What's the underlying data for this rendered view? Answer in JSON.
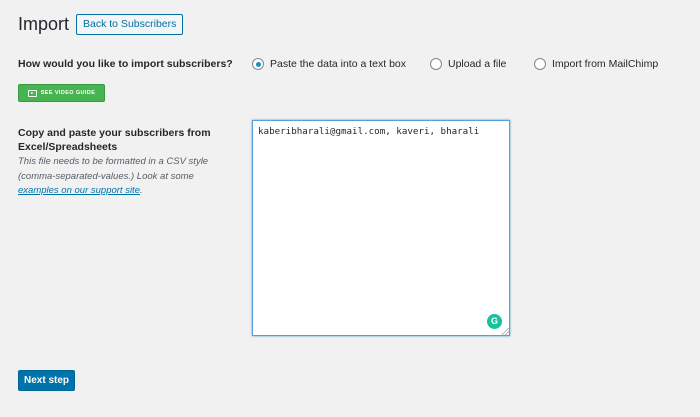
{
  "header": {
    "title": "Import",
    "back_label": "Back to Subscribers"
  },
  "method": {
    "question": "How would you like to import subscribers?",
    "options": [
      {
        "label": "Paste the data into a text box",
        "selected": true
      },
      {
        "label": "Upload a file",
        "selected": false
      },
      {
        "label": "Import from MailChimp",
        "selected": false
      }
    ],
    "video_guide_label": "SEE VIDEO GUIDE"
  },
  "paste": {
    "label": "Copy and paste your subscribers from Excel/Spreadsheets",
    "hint_prefix": "This file needs to be formatted in a CSV style (comma-separated-values.) Look at some ",
    "hint_link": "examples on our support site",
    "hint_suffix": ".",
    "textarea_value": "kaberibharali@gmail.com, kaveri, bharali"
  },
  "footer": {
    "next_label": "Next step"
  },
  "colors": {
    "primary": "#0073aa",
    "success": "#46b450",
    "grammarly": "#15c39a"
  },
  "icons": {
    "video": "video-icon",
    "grammarly": "grammarly-icon"
  }
}
